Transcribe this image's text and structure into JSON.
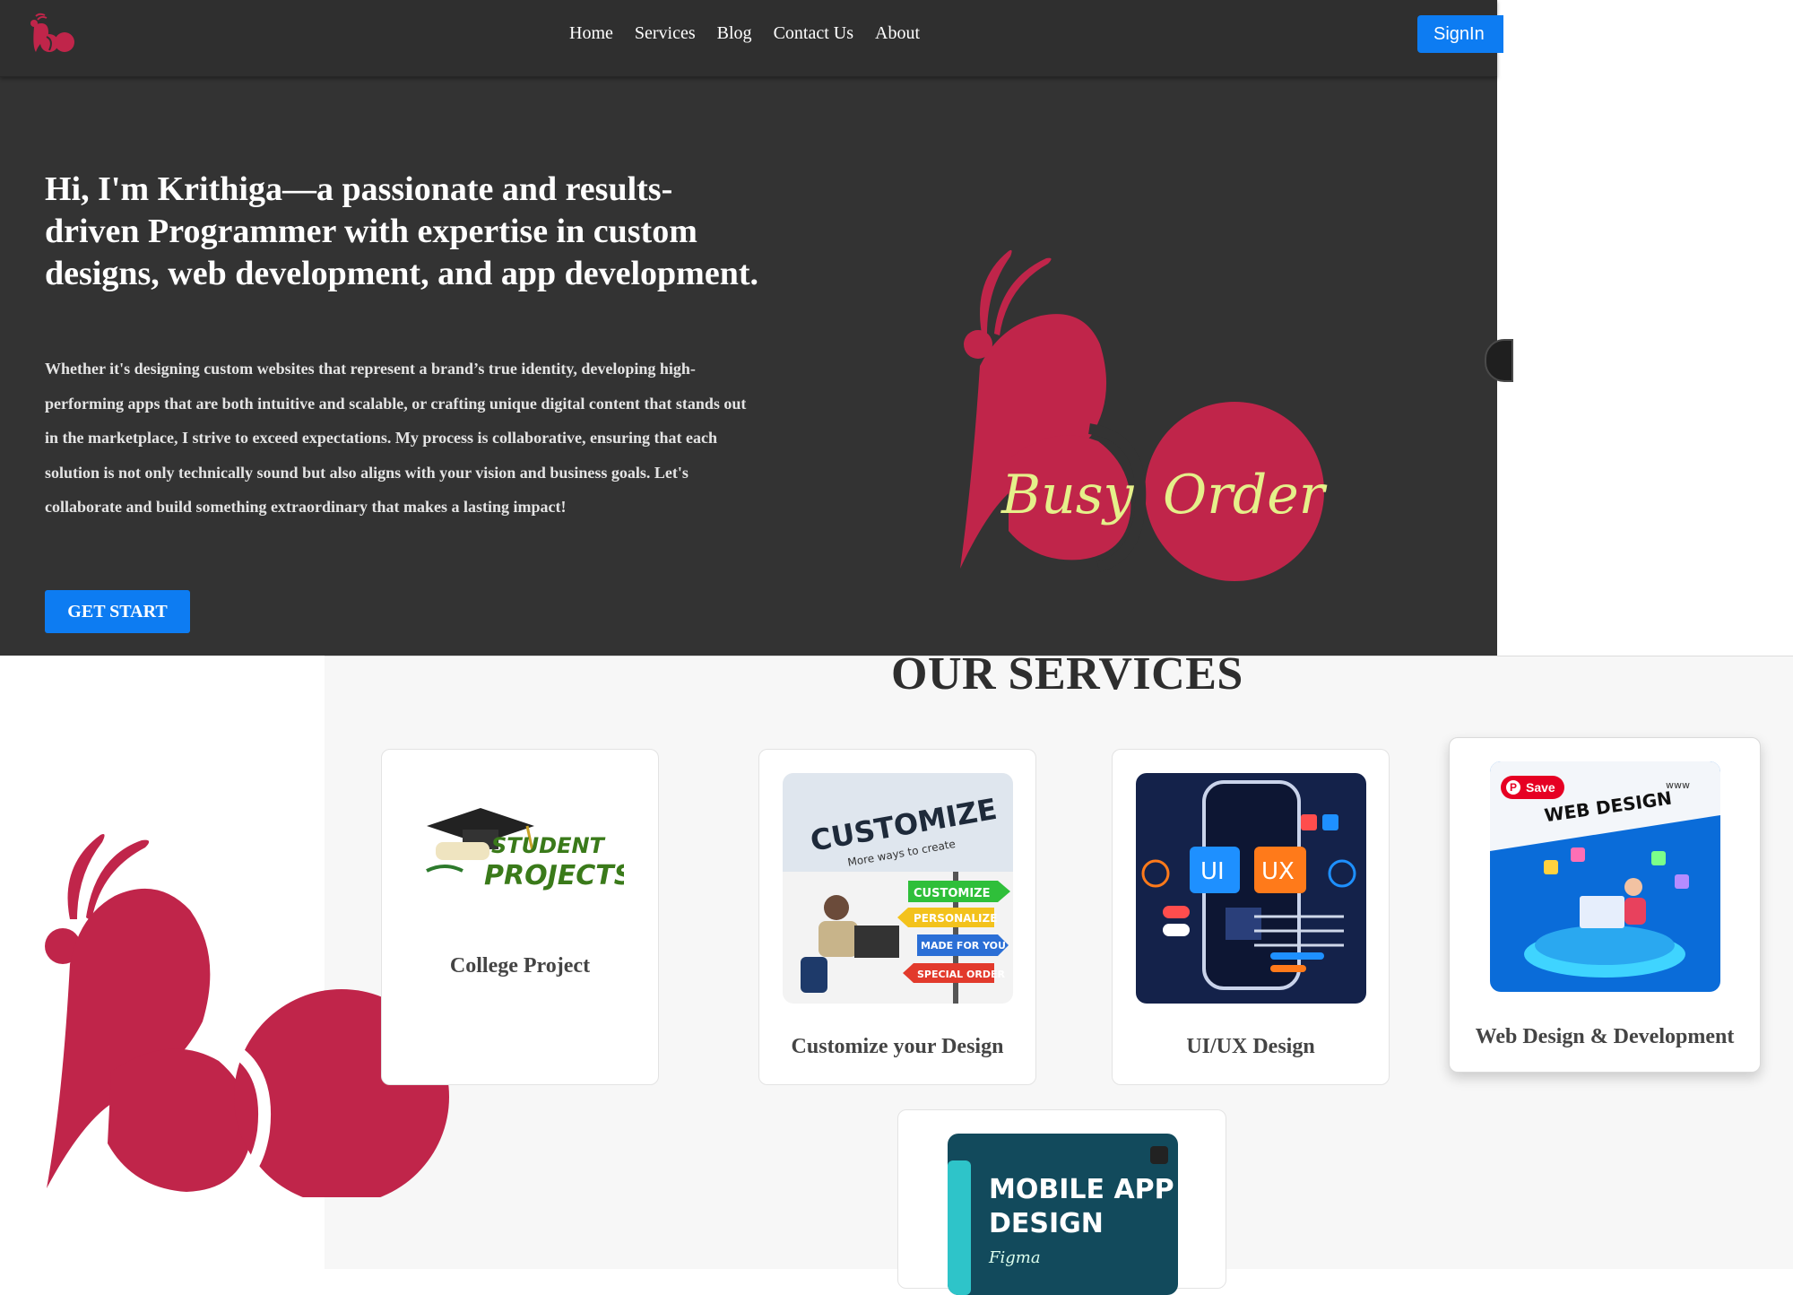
{
  "nav": {
    "links": [
      "Home",
      "Services",
      "Blog",
      "Contact Us",
      "About"
    ],
    "signin_label": "SignIn"
  },
  "hero": {
    "title": "Hi, I'm Krithiga—a passionate and results-driven Programmer with expertise in custom designs, web development, and app development.",
    "body": "Whether it's designing custom websites that represent a brand’s true identity, developing high-performing apps that are both intuitive and scalable, or crafting unique digital content that stands out in the marketplace, I strive to exceed expectations. My process is collaborative, ensuring that each solution is not only technically sound but also aligns with your vision and business goals. Let's collaborate and build something extraordinary that makes a lasting impact!",
    "cta_label": "GET START",
    "logo_text_1": "Busy",
    "logo_text_2": "Order"
  },
  "services": {
    "title": "OUR SERVICES",
    "cards": [
      {
        "label": "College Project",
        "image_text_1": "STUDENT",
        "image_text_2": "PROJECTS"
      },
      {
        "label": "Customize your Design",
        "image_text_1": "CUSTOMIZE",
        "image_text_2": "More ways to create",
        "signs": [
          "CUSTOMIZE",
          "PERSONALIZE",
          "MADE FOR YOU",
          "SPECIAL ORDER"
        ]
      },
      {
        "label": "UI/UX Design",
        "image_text_1": "UI",
        "image_text_2": "UX"
      },
      {
        "label": "Web Design & Development",
        "image_text_1": "WEB DESIGN",
        "image_text_2": "www",
        "save_label": "Save"
      },
      {
        "label": "",
        "image_text_1": "MOBILE APP",
        "image_text_2": "DESIGN",
        "image_text_3": "Figma"
      }
    ]
  },
  "colors": {
    "brand_red": "#c0254a",
    "logo_script": "#e5f08a",
    "primary_blue": "#0d7cf2",
    "dark_bg": "#333333"
  }
}
